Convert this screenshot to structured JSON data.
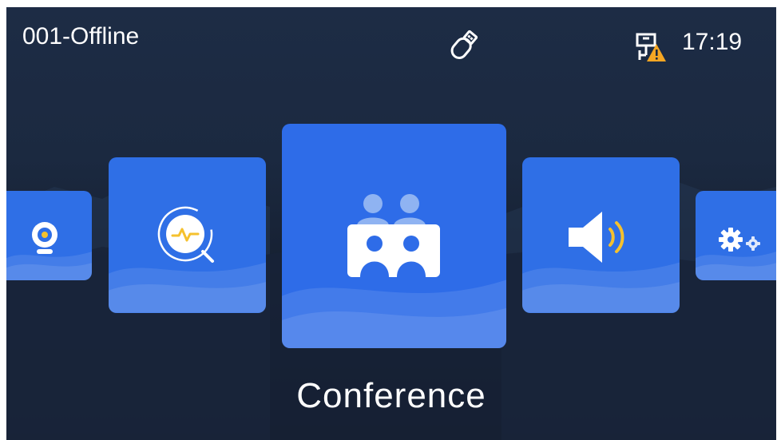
{
  "status_bar": {
    "device_status": "001-Offline",
    "time": "17:19",
    "icons": [
      "usb-icon",
      "network-warning-icon"
    ]
  },
  "carousel": {
    "items": [
      {
        "name": "camera",
        "icon": "camera-icon"
      },
      {
        "name": "diagnostic",
        "icon": "diagnostic-icon"
      },
      {
        "name": "conference",
        "icon": "conference-icon"
      },
      {
        "name": "audio",
        "icon": "speaker-icon"
      },
      {
        "name": "settings",
        "icon": "settings-gear-icon"
      }
    ],
    "selected_label": "Conference"
  },
  "colors": {
    "tile": "#2f6fe6",
    "accent_yellow": "#f5c12e",
    "warning": "#f5a623",
    "background": "#18243a"
  }
}
